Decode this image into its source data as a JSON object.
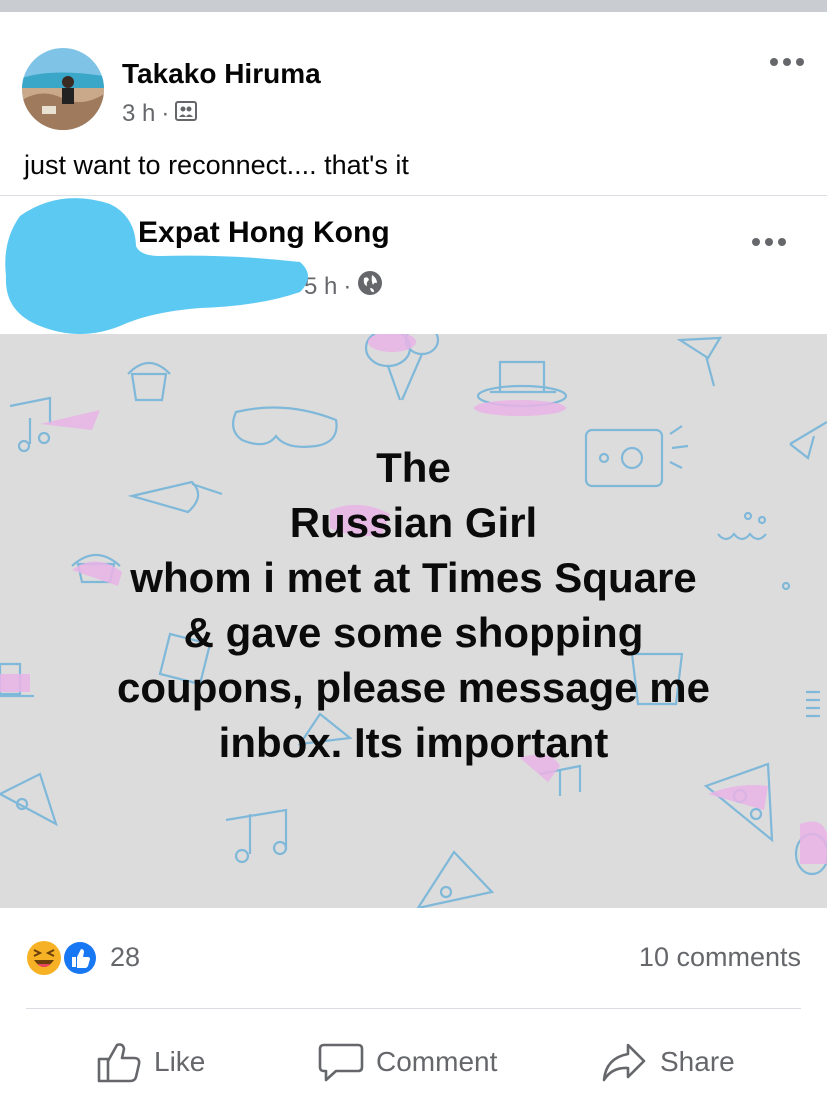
{
  "share_post": {
    "author": "Takako Hiruma",
    "time": "3 h",
    "separator": "·",
    "audience_icon": "friends-icon",
    "caption": "just want to reconnect.... that's it",
    "more_icon": "more-horizontal-icon"
  },
  "original_post": {
    "group": "Expat Hong Kong",
    "meta_prefix": "·",
    "time": "5 h",
    "separator": "·",
    "audience_icon": "globe-icon",
    "more_icon": "more-horizontal-icon",
    "text_lines": [
      "The",
      "Russian Girl",
      "whom i met at Times Square",
      "& gave some shopping",
      "coupons, please message me",
      "inbox. Its important"
    ],
    "background_color": "#dcdcdc"
  },
  "engagement": {
    "reaction_icons": [
      "haha-reaction-icon",
      "like-reaction-icon"
    ],
    "reaction_count": "28",
    "comments": "10 comments"
  },
  "actions": {
    "like": "Like",
    "comment": "Comment",
    "share": "Share"
  },
  "colors": {
    "secondary_text": "#65676b",
    "like_blue": "#1877f2",
    "haha_yellow": "#f7b125",
    "redaction_blue": "#5bc9f2"
  }
}
